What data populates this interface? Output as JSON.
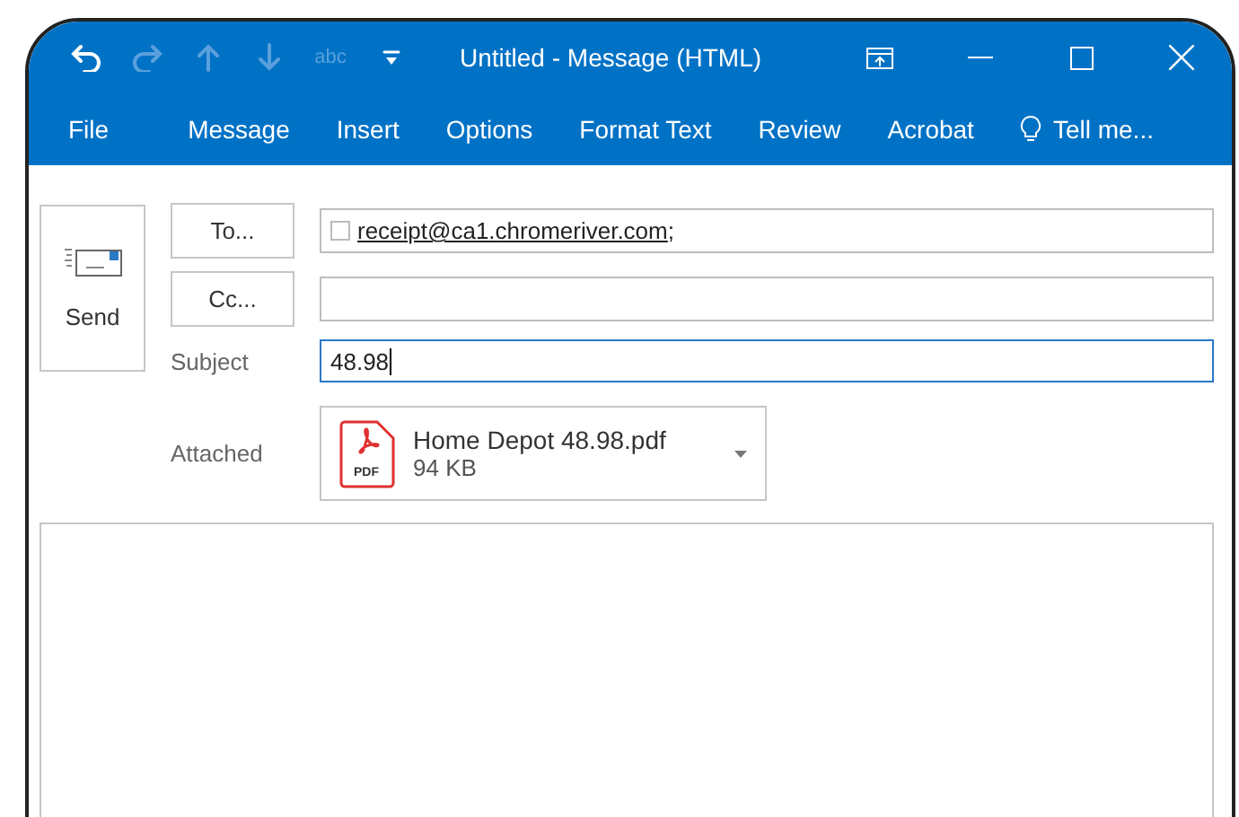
{
  "quick_access": [
    {
      "kind": "undo",
      "disabled": false
    },
    {
      "kind": "redo",
      "disabled": true
    },
    {
      "kind": "up",
      "disabled": true
    },
    {
      "kind": "down",
      "disabled": true
    },
    {
      "kind": "spelling",
      "label": "abc",
      "disabled": true
    },
    {
      "kind": "customize",
      "disabled": false
    }
  ],
  "window": {
    "title": "Untitled - Message (HTML)"
  },
  "ribbon_tabs": [
    {
      "label": "File"
    },
    {
      "label": "Message"
    },
    {
      "label": "Insert"
    },
    {
      "label": "Options"
    },
    {
      "label": "Format Text"
    },
    {
      "label": "Review"
    },
    {
      "label": "Acrobat"
    },
    {
      "label": "Tell me...",
      "kind": "tell"
    }
  ],
  "send_button": {
    "label": "Send"
  },
  "to": {
    "button": "To...",
    "recipient": "receipt@ca1.chromeriver.com",
    "separator": ";"
  },
  "cc": {
    "button": "Cc..."
  },
  "subject": {
    "label": "Subject",
    "value": "48.98",
    "focused": true
  },
  "attachment": {
    "label": "Attached",
    "file_name": "Home Depot 48.98.pdf",
    "size": "94 KB",
    "icon_text": "PDF"
  }
}
